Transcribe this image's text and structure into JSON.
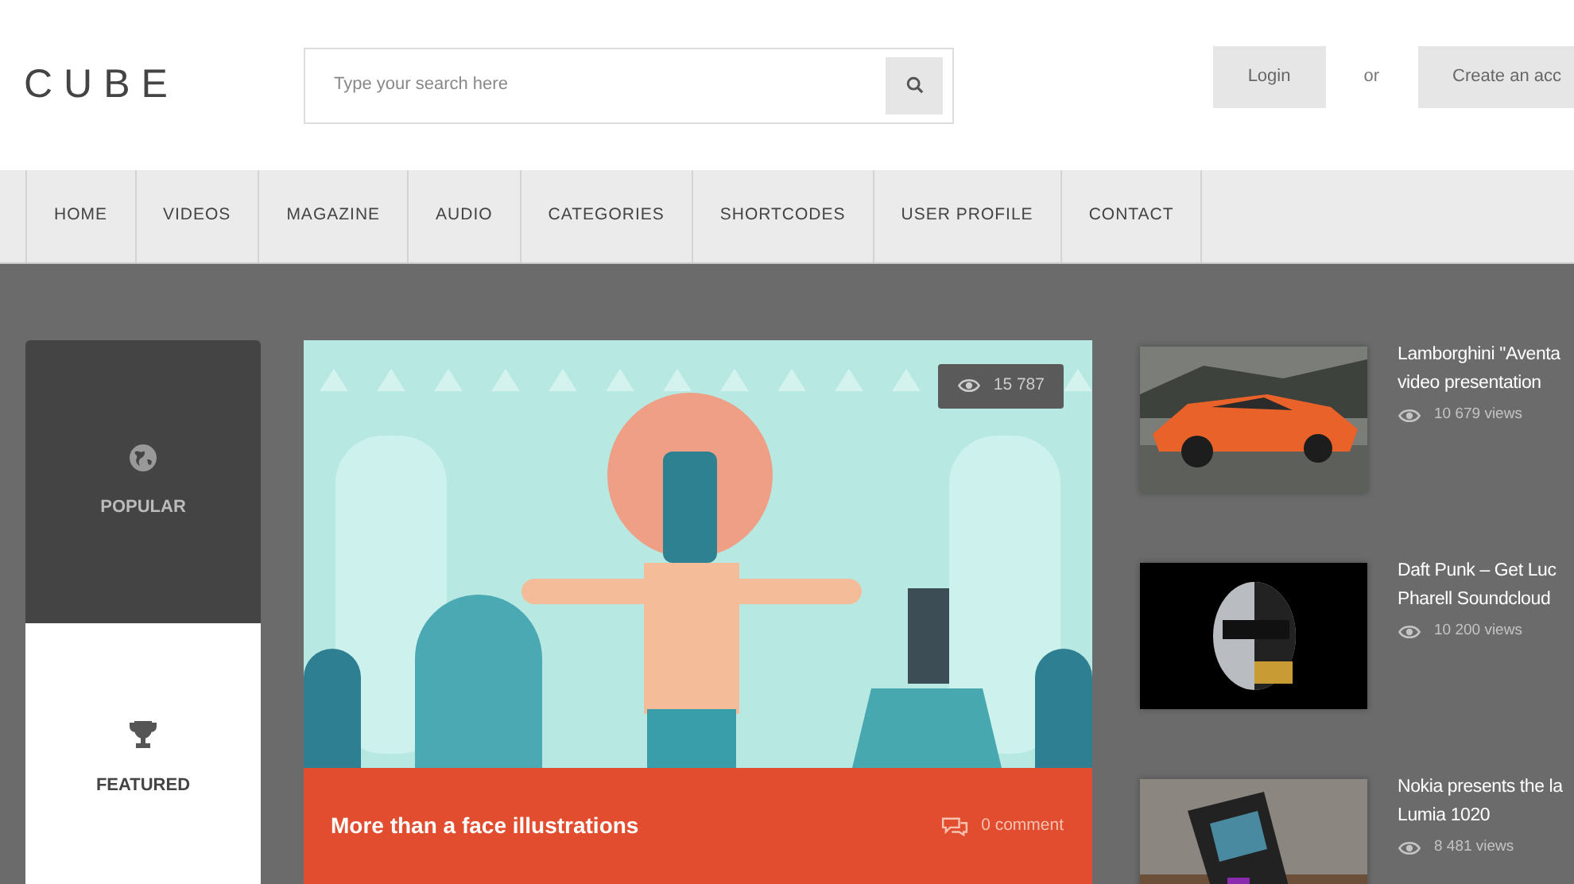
{
  "logo": "CUBE",
  "search": {
    "placeholder": "Type your search here"
  },
  "auth": {
    "login": "Login",
    "separator": "or",
    "create": "Create an acc"
  },
  "nav": [
    {
      "label": "HOME"
    },
    {
      "label": "VIDEOS"
    },
    {
      "label": "MAGAZINE"
    },
    {
      "label": "AUDIO"
    },
    {
      "label": "CATEGORIES"
    },
    {
      "label": "SHORTCODES"
    },
    {
      "label": "USER PROFILE"
    },
    {
      "label": "CONTACT"
    }
  ],
  "sidebar_tabs": [
    {
      "label": "POPULAR",
      "selected": false
    },
    {
      "label": "FEATURED",
      "selected": true
    }
  ],
  "featured": {
    "kind": "picture",
    "views": "15 787",
    "title": "More than a face illustrations",
    "comments": "0 comment"
  },
  "videos": [
    {
      "title_lines": [
        "Lamborghini \"Aventa",
        "video presentation"
      ],
      "views": "10 679 views"
    },
    {
      "title_lines": [
        "Daft Punk – Get Luc",
        "Pharell Soundcloud"
      ],
      "views": "10 200 views"
    },
    {
      "title_lines": [
        "Nokia presents the la",
        "Lumia 1020"
      ],
      "views": "8 481 views"
    }
  ]
}
